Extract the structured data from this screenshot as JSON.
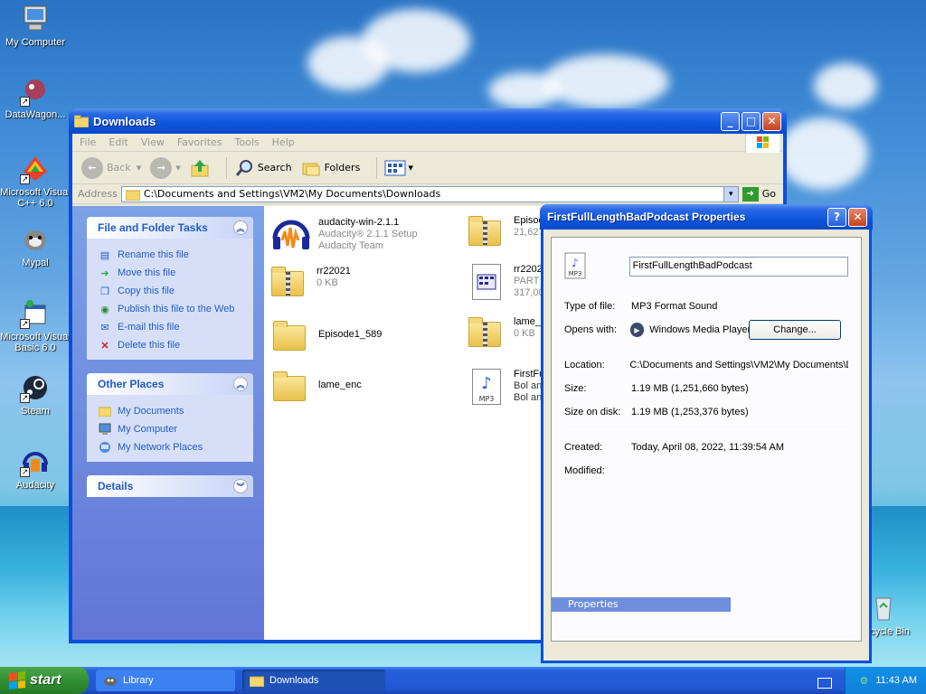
{
  "desktop": {
    "icons": [
      {
        "label": "My Computer",
        "icon": "computer-icon"
      },
      {
        "label": "DataWagon...",
        "icon": "datawagon-icon"
      },
      {
        "label": "Microsoft Visual C++ 6.0",
        "icon": "visual-cpp-icon"
      },
      {
        "label": "Mypal",
        "icon": "mypal-icon"
      },
      {
        "label": "Microsoft Visual Basic 6.0",
        "icon": "visual-basic-icon"
      },
      {
        "label": "Steam",
        "icon": "steam-icon"
      },
      {
        "label": "Audacity",
        "icon": "audacity-icon"
      },
      {
        "label": "Recycle Bin",
        "icon": "recycle-bin-icon"
      }
    ]
  },
  "explorer": {
    "title": "Downloads",
    "menu": [
      "File",
      "Edit",
      "View",
      "Favorites",
      "Tools",
      "Help"
    ],
    "toolbar": {
      "back": "Back",
      "search": "Search",
      "folders": "Folders"
    },
    "address": {
      "label": "Address",
      "path": "C:\\Documents and Settings\\VM2\\My Documents\\Downloads",
      "go": "Go"
    },
    "tasks": {
      "title": "File and Folder Tasks",
      "items": [
        "Rename this file",
        "Move this file",
        "Copy this file",
        "Publish this file to the Web",
        "E-mail this file",
        "Delete this file"
      ]
    },
    "other_places": {
      "title": "Other Places",
      "items": [
        "My Documents",
        "My Computer",
        "My Network Places"
      ]
    },
    "details": {
      "title": "Details"
    },
    "files": [
      {
        "name": "audacity-win-2.1.1",
        "line2": "Audacity® 2.1.1 Setup",
        "line3": "Audacity Team"
      },
      {
        "name": "Episode",
        "line2": "21,627",
        "line3": ""
      },
      {
        "name": "rr22021",
        "line2": "0 KB",
        "line3": ""
      },
      {
        "name": "rr2202",
        "line2": "PART F",
        "line3": "317,00"
      },
      {
        "name": "Episode1_589",
        "line2": "",
        "line3": ""
      },
      {
        "name": "lame_e",
        "line2": "0 KB",
        "line3": ""
      },
      {
        "name": "lame_enc",
        "line2": "",
        "line3": ""
      },
      {
        "name": "FirstFu",
        "line2": "Bol and",
        "line3": "Bol and"
      }
    ]
  },
  "properties": {
    "title": "FirstFullLengthBadPodcast Properties",
    "filename": "FirstFullLengthBadPodcast",
    "type_label": "Type of file:",
    "type_value": "MP3 Format Sound",
    "opens_label": "Opens with:",
    "opens_value": "Windows Media Player",
    "change": "Change...",
    "location_label": "Location:",
    "location_value": "C:\\Documents and Settings\\VM2\\My Documents\\D",
    "size_label": "Size:",
    "size_value": "1.19 MB (1,251,660 bytes)",
    "sod_label": "Size on disk:",
    "sod_value": "1.19 MB (1,253,376 bytes)",
    "created_label": "Created:",
    "created_value": "Today, April 08, 2022, 11:39:54 AM",
    "modified_label": "Modified:",
    "tab": "Properties"
  },
  "taskbar": {
    "start": "start",
    "tasks": [
      "Library",
      "Downloads"
    ],
    "clock": "11:43 AM"
  }
}
